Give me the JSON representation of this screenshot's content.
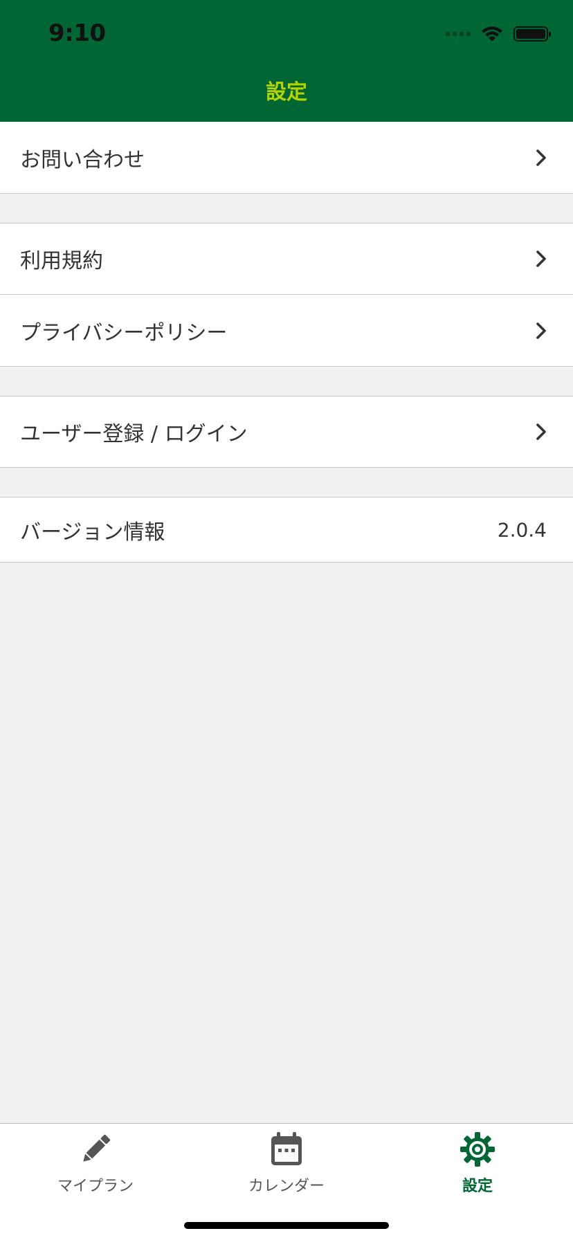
{
  "status_bar": {
    "time": "9:10",
    "icons": [
      "signal-icon",
      "wifi-icon",
      "battery-icon"
    ]
  },
  "nav": {
    "title": "設定"
  },
  "settings": {
    "contact": {
      "label": "お問い合わせ",
      "icon": "chevron-right-icon"
    },
    "terms": {
      "label": "利用規約",
      "icon": "chevron-right-icon"
    },
    "privacy": {
      "label": "プライバシーポリシー",
      "icon": "chevron-right-icon"
    },
    "account": {
      "label": "ユーザー登録 / ログイン",
      "icon": "chevron-right-icon"
    },
    "version": {
      "label": "バージョン情報",
      "value": "2.0.4"
    }
  },
  "tabs": [
    {
      "label": "マイプラン",
      "icon": "pencil-icon",
      "active": false
    },
    {
      "label": "カレンダー",
      "icon": "calendar-icon",
      "active": false
    },
    {
      "label": "設定",
      "icon": "gear-icon",
      "active": true
    }
  ],
  "colors": {
    "header_bg": "#006633",
    "title_text": "#b5d300",
    "active_tab": "#006633",
    "inactive_tab": "#555555",
    "background": "#f1f1f1"
  }
}
